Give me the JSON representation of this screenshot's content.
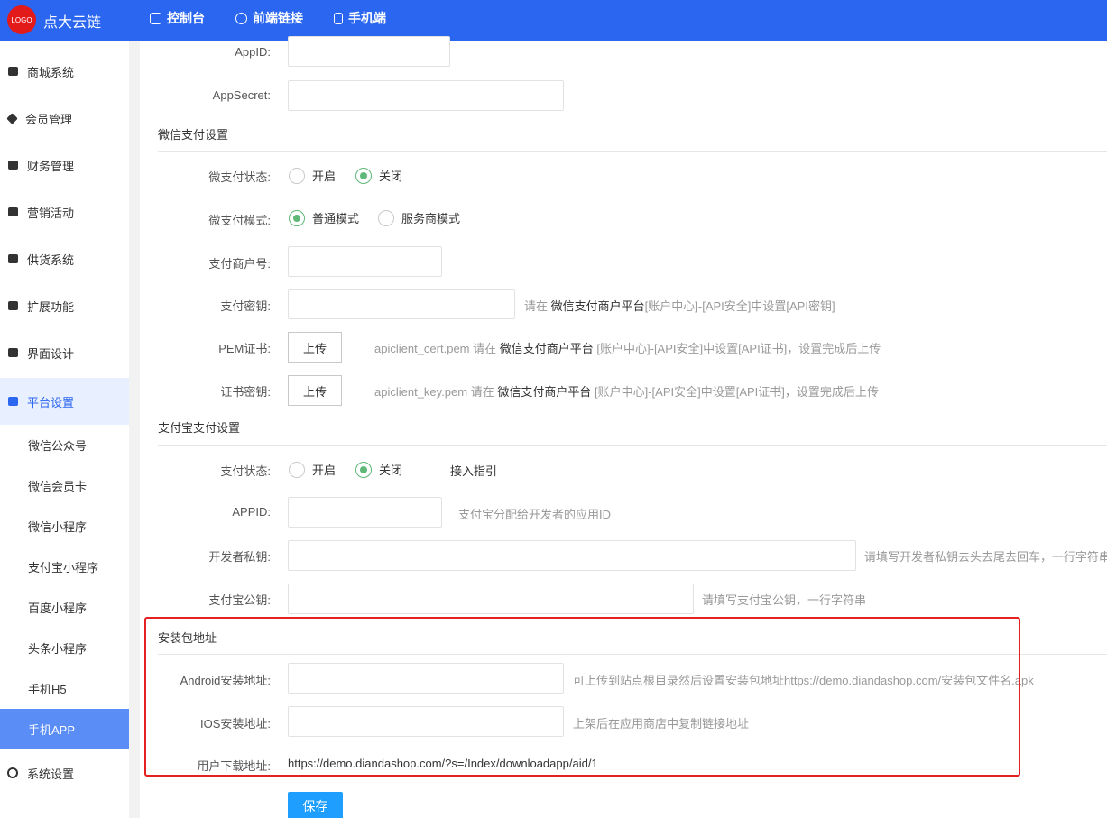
{
  "header": {
    "logo_text": "LOGO",
    "brand": "点大云链",
    "nav": [
      {
        "label": "控制台",
        "icon": "dashboard-icon"
      },
      {
        "label": "前端链接",
        "icon": "link-icon"
      },
      {
        "label": "手机端",
        "icon": "mobile-icon"
      }
    ]
  },
  "sidebar": {
    "items": [
      {
        "label": "商城系统"
      },
      {
        "label": "会员管理"
      },
      {
        "label": "财务管理"
      },
      {
        "label": "营销活动"
      },
      {
        "label": "供货系统"
      },
      {
        "label": "扩展功能"
      },
      {
        "label": "界面设计"
      },
      {
        "label": "平台设置"
      }
    ],
    "sub_items": [
      {
        "label": "微信公众号"
      },
      {
        "label": "微信会员卡"
      },
      {
        "label": "微信小程序"
      },
      {
        "label": "支付宝小程序"
      },
      {
        "label": "百度小程序"
      },
      {
        "label": "头条小程序"
      },
      {
        "label": "手机H5"
      },
      {
        "label": "手机APP"
      }
    ],
    "system": "系统设置"
  },
  "form": {
    "appid_label": "AppID:",
    "appsecret_label": "AppSecret:",
    "wxpay": {
      "title": "微信支付设置",
      "status_label": "微支付状态:",
      "status_on": "开启",
      "status_off": "关闭",
      "mode_label": "微支付模式:",
      "mode_normal": "普通模式",
      "mode_service": "服务商模式",
      "merchant_label": "支付商户号:",
      "key_label": "支付密钥:",
      "key_hint_pre": "请在",
      "key_hint_link": "微信支付商户平台",
      "key_hint_post": "[账户中心]-[API安全]中设置[API密钥]",
      "pem_label": "PEM证书:",
      "upload": "上传",
      "pem_hint_pre": "apiclient_cert.pem 请在",
      "pem_hint_link": "微信支付商户平台",
      "pem_hint_post": "[账户中心]-[API安全]中设置[API证书]，设置完成后上传",
      "certkey_label": "证书密钥:",
      "certkey_hint_pre": "apiclient_key.pem 请在",
      "certkey_hint_link": "微信支付商户平台",
      "certkey_hint_post": "[账户中心]-[API安全]中设置[API证书]，设置完成后上传"
    },
    "alipay": {
      "title": "支付宝支付设置",
      "status_label": "支付状态:",
      "status_on": "开启",
      "status_off": "关闭",
      "guide": "接入指引",
      "appid_label": "APPID:",
      "appid_hint": "支付宝分配给开发者的应用ID",
      "privkey_label": "开发者私钥:",
      "privkey_hint": "请填写开发者私钥去头去尾去回车，一行字符串",
      "pubkey_label": "支付宝公钥:",
      "pubkey_hint": "请填写支付宝公钥，一行字符串"
    },
    "package": {
      "title": "安装包地址",
      "android_label": "Android安装地址:",
      "android_hint": "可上传到站点根目录然后设置安装包地址https://demo.diandashop.com/安装包文件名.apk",
      "ios_label": "IOS安装地址:",
      "ios_hint": "上架后在应用商店中复制链接地址",
      "download_label": "用户下载地址:",
      "download_url": "https://demo.diandashop.com/?s=/Index/downloadapp/aid/1"
    },
    "save": "保存"
  },
  "colors": {
    "header": "#2b66f0",
    "active_sub": "#5b8df6",
    "radio_checked": "#5fb878",
    "save": "#1e9fff",
    "highlight": "#e52020"
  }
}
